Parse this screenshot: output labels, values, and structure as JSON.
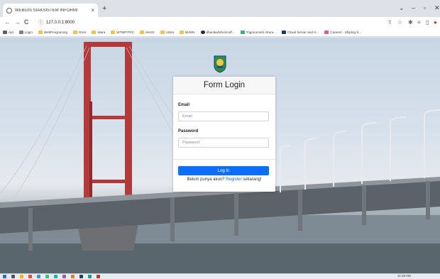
{
  "browser": {
    "tab_title": "WEBGIS SIAKSISTEM INFORM/",
    "tab_close": "×",
    "new_tab": "+",
    "address": "127.0.0.1:8000",
    "nav": {
      "back": "←",
      "forward": "→",
      "reload": "C"
    },
    "bookmarks": [
      {
        "label": "Apl",
        "color": "#5f6368"
      },
      {
        "label": "Login",
        "color": "#7b8088"
      },
      {
        "label": "WebPrograming",
        "color": "#f2c14e"
      },
      {
        "label": "Docs",
        "color": "#f2c14e"
      },
      {
        "label": "Wara",
        "color": "#f2c14e"
      },
      {
        "label": "WTMPITRC",
        "color": "#f2c14e"
      },
      {
        "label": "stm32",
        "color": "#f2c14e"
      },
      {
        "label": "cobra",
        "color": "#f2c14e"
      },
      {
        "label": "BUMN",
        "color": "#f2c14e"
      },
      {
        "label": "dbanika/tshortcoff...",
        "color": "#24292e"
      },
      {
        "label": "Trigonometri Akura...",
        "color": "#36b37e"
      },
      {
        "label": "Cloud Server and H...",
        "color": "#1a3a6b"
      },
      {
        "label": "Careers - Shiplog S...",
        "color": "#e8588f"
      }
    ]
  },
  "login": {
    "title": "Form Login",
    "email_label": "Email",
    "email_placeholder": "Email",
    "password_label": "Password",
    "password_placeholder": "Password",
    "submit_label": "Log In",
    "register_prefix": "Belum punya akun?",
    "register_link": "Register",
    "register_suffix": "sekarang!"
  },
  "taskbar": {
    "clock": "11:19 AM"
  },
  "colors": {
    "primary": "#0d6efd",
    "card_header_bg": "#f7f7f7"
  }
}
